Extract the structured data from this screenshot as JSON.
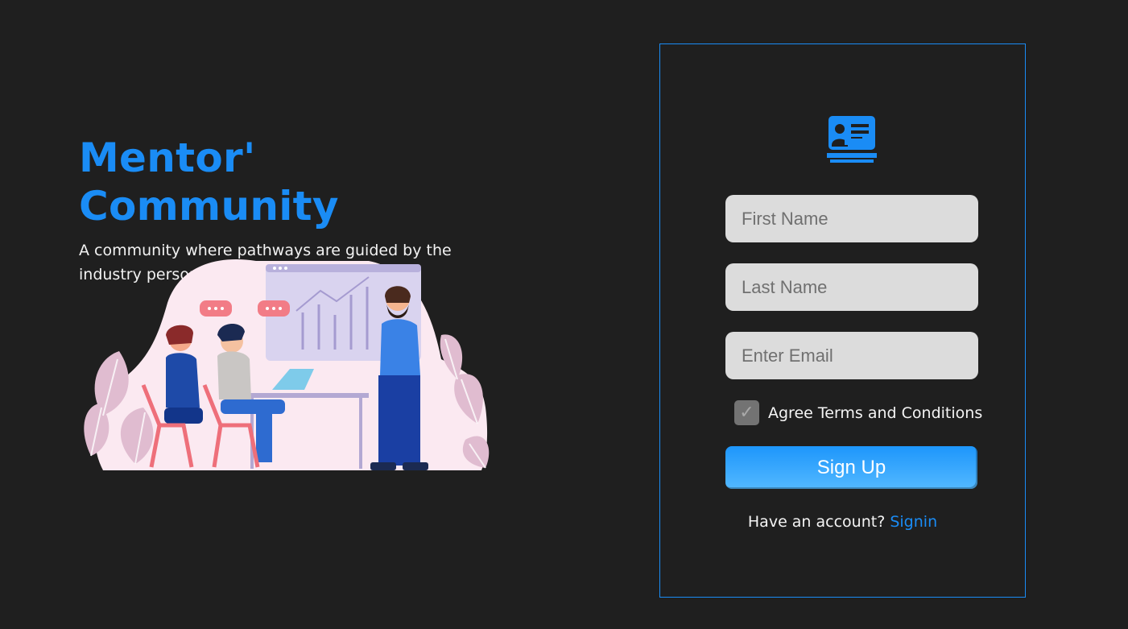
{
  "hero": {
    "title": "Mentor' Community",
    "subtitle": "A community where pathways are guided by the industry personnal to the interested folks."
  },
  "illustration": {
    "icon": "team-meeting-illustration"
  },
  "form": {
    "logo_icon": "mentor-presentation-icon",
    "first_name_placeholder": "First Name",
    "last_name_placeholder": "Last Name",
    "email_placeholder": "Enter Email",
    "terms_checked": true,
    "terms_label": "Agree Terms and Conditions",
    "signup_label": "Sign Up",
    "account_prompt": "Have an account?",
    "signin_label": "Signin"
  },
  "colors": {
    "background": "#1f1f1f",
    "accent": "#1a8cf5",
    "input_bg": "#dcdcdc"
  }
}
